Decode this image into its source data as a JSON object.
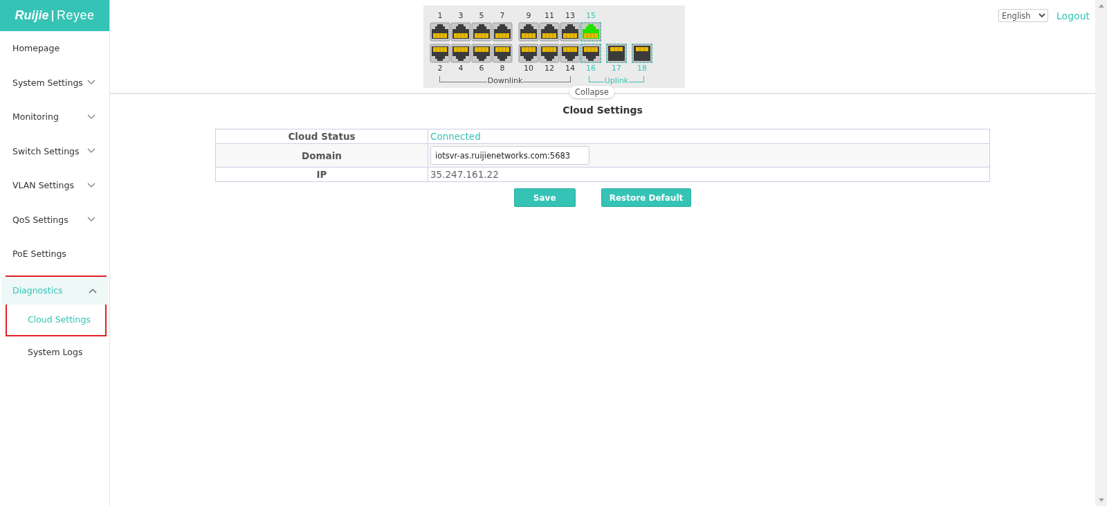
{
  "logo": {
    "brand": "Ruijie",
    "product": "Reyee"
  },
  "sidebar": {
    "items": [
      {
        "label": "Homepage",
        "expandable": false,
        "expanded": false,
        "highlighted": false
      },
      {
        "label": "System Settings",
        "expandable": true,
        "expanded": false,
        "highlighted": false
      },
      {
        "label": "Monitoring",
        "expandable": true,
        "expanded": false,
        "highlighted": false
      },
      {
        "label": "Switch Settings",
        "expandable": true,
        "expanded": false,
        "highlighted": false
      },
      {
        "label": "VLAN Settings",
        "expandable": true,
        "expanded": false,
        "highlighted": false
      },
      {
        "label": "QoS Settings",
        "expandable": true,
        "expanded": false,
        "highlighted": false
      },
      {
        "label": "PoE Settings",
        "expandable": false,
        "expanded": false,
        "highlighted": false
      },
      {
        "label": "Diagnostics",
        "expandable": true,
        "expanded": true,
        "highlighted": true,
        "children": [
          {
            "label": "Cloud Settings",
            "selected": true,
            "highlighted": true
          },
          {
            "label": "System Logs",
            "selected": false,
            "highlighted": false
          }
        ]
      }
    ]
  },
  "switch_panel": {
    "groups": [
      {
        "label": "Downlink",
        "uplink": false,
        "columns": [
          {
            "top": {
              "label": "1",
              "kind": "rj45",
              "link_up": false
            },
            "bottom": {
              "label": "2",
              "kind": "rj45",
              "link_up": false
            }
          },
          {
            "top": {
              "label": "3",
              "kind": "rj45",
              "link_up": false
            },
            "bottom": {
              "label": "4",
              "kind": "rj45",
              "link_up": false
            }
          },
          {
            "top": {
              "label": "5",
              "kind": "rj45",
              "link_up": false
            },
            "bottom": {
              "label": "6",
              "kind": "rj45",
              "link_up": false
            }
          },
          {
            "top": {
              "label": "7",
              "kind": "rj45",
              "link_up": false
            },
            "bottom": {
              "label": "8",
              "kind": "rj45",
              "link_up": false
            }
          },
          {
            "top": {
              "label": "9",
              "kind": "rj45",
              "link_up": false
            },
            "bottom": {
              "label": "10",
              "kind": "rj45",
              "link_up": false
            }
          },
          {
            "top": {
              "label": "11",
              "kind": "rj45",
              "link_up": false
            },
            "bottom": {
              "label": "12",
              "kind": "rj45",
              "link_up": false
            }
          },
          {
            "top": {
              "label": "13",
              "kind": "rj45",
              "link_up": false
            },
            "bottom": {
              "label": "14",
              "kind": "rj45",
              "link_up": false
            }
          }
        ]
      },
      {
        "label": "Uplink",
        "uplink": true,
        "columns": [
          {
            "top": {
              "label": "15",
              "kind": "rj45",
              "link_up": true
            },
            "bottom": {
              "label": "16",
              "kind": "rj45",
              "link_up": false
            }
          },
          {
            "bottom": {
              "label": "17",
              "kind": "sfp",
              "link_up": false
            }
          },
          {
            "bottom": {
              "label": "18",
              "kind": "sfp",
              "link_up": false
            }
          }
        ]
      }
    ],
    "collapse": "Collapse"
  },
  "header": {
    "language": "English",
    "logout": "Logout"
  },
  "page_title": "Cloud Settings",
  "form": {
    "rows": [
      {
        "label": "Cloud Status",
        "kind": "status",
        "value": "Connected"
      },
      {
        "label": "Domain",
        "kind": "input",
        "value": "iotsvr-as.ruijienetworks.com:5683"
      },
      {
        "label": "IP",
        "kind": "text",
        "value": "35.247.161.22"
      }
    ]
  },
  "buttons": [
    "Save",
    "Restore Default"
  ]
}
